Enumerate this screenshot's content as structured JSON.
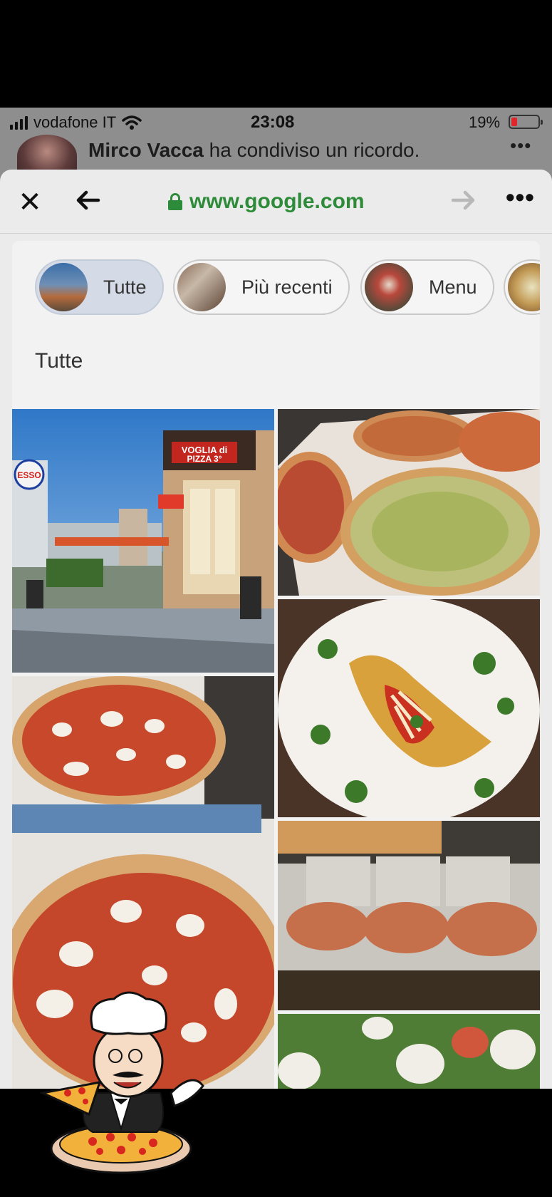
{
  "status_bar": {
    "carrier": "vodafone IT",
    "time": "23:08",
    "battery_percent": "19%",
    "battery_level": 0.19
  },
  "facebook_behind": {
    "user_name": "Mirco Vacca",
    "post_text_rest": "ha condiviso un ricordo."
  },
  "browser": {
    "close_icon": "close-icon",
    "back_icon": "back-arrow-icon",
    "url": "www.google.com",
    "forward_icon": "forward-arrow-icon",
    "more_icon": "more-icon"
  },
  "filter_chips": [
    {
      "label": "Tutte",
      "selected": true
    },
    {
      "label": "Più recenti",
      "selected": false
    },
    {
      "label": "Menu",
      "selected": false
    }
  ],
  "section_title": "Tutte",
  "photos": [
    {
      "subject": "Pizzeria storefront at dusk with sign 'Voglia di Pizza 3'",
      "sign_text": "VOGLIA di PIZZA 3°",
      "side_sign": "ESSO"
    },
    {
      "subject": "Several pizzas in delivery boxes"
    },
    {
      "subject": "Breaded cutlet with tomato, cheese and arugula on a plate"
    },
    {
      "subject": "Two margherita pizzas with mozzarella"
    },
    {
      "subject": "Pizza bases on a counter in the kitchen"
    },
    {
      "subject": "Pizza with arugula and burrata"
    }
  ],
  "colors": {
    "url_green": "#2e8b3a",
    "battery_red": "#e0262b",
    "chip_selected": "#d4dbe6"
  }
}
